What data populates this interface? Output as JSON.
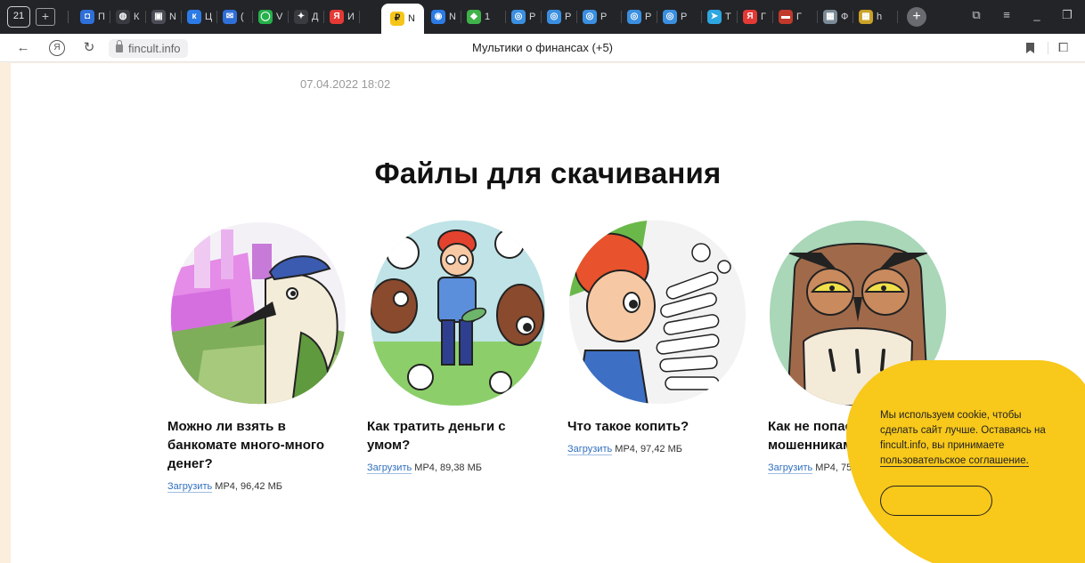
{
  "tabs": [
    {
      "title": "П",
      "color": "#2f6fd8",
      "glyph": "◘"
    },
    {
      "title": "К",
      "color": "#3a3b40",
      "glyph": "◍"
    },
    {
      "title": "N",
      "color": "#4a4b55",
      "glyph": "▣"
    },
    {
      "title": "Ц",
      "color": "#2c7be5",
      "glyph": "к"
    },
    {
      "title": "(",
      "color": "#2f6fd8",
      "glyph": "✉"
    },
    {
      "title": "V",
      "color": "#25b04a",
      "glyph": "◯"
    },
    {
      "title": "Д",
      "color": "#3a3b40",
      "glyph": "✦"
    },
    {
      "title": "И",
      "color": "#e53935",
      "glyph": "Я"
    },
    {
      "title": "N",
      "color": "#f5c518",
      "glyph": "₽"
    },
    {
      "title": "N",
      "color": "#2c7be5",
      "glyph": "◉"
    },
    {
      "title": "1",
      "color": "#3fb24a",
      "glyph": "◆"
    },
    {
      "title": "Р",
      "color": "#3b8fe0",
      "glyph": "◎"
    },
    {
      "title": "Р",
      "color": "#3b8fe0",
      "glyph": "◎"
    },
    {
      "title": "Р",
      "color": "#3b8fe0",
      "glyph": "◎"
    },
    {
      "title": "Р",
      "color": "#3b8fe0",
      "glyph": "◎"
    },
    {
      "title": "Р",
      "color": "#3b8fe0",
      "glyph": "◎"
    },
    {
      "title": "Т",
      "color": "#2ea6e0",
      "glyph": "➤"
    },
    {
      "title": "Г",
      "color": "#e53935",
      "glyph": "Я"
    },
    {
      "title": "Г",
      "color": "#c0392b",
      "glyph": "▬"
    },
    {
      "title": "Ф",
      "color": "#7a8a96",
      "glyph": "▦"
    },
    {
      "title": "h",
      "color": "#c9a227",
      "glyph": "▦"
    }
  ],
  "home_badge": "21",
  "address_bar": {
    "url": "fincult.info",
    "title": "Мультики о финансах (+5)"
  },
  "page": {
    "date": "07.04.2022 18:02",
    "heading": "Файлы для скачивания",
    "cards": [
      {
        "title": "Можно ли взять в банкомате много-много денег?",
        "link": "Загрузить",
        "meta": "MP4, 96,42 МБ"
      },
      {
        "title": "Как тратить деньги с умом?",
        "link": "Загрузить",
        "meta": "MP4, 89,38 МБ"
      },
      {
        "title": "Что такое копить?",
        "link": "Загрузить",
        "meta": "MP4, 97,42 МБ"
      },
      {
        "title": "Как не попасться мошенникам?",
        "link": "Загрузить",
        "meta": "MP4, 75"
      }
    ]
  },
  "cookie": {
    "text": "Мы используем cookie, чтобы сделать сайт лучше. Оставаясь на fincult.info, вы принимаете",
    "link": "пользовательское соглашение."
  },
  "colors": {
    "link": "#2f6fbf",
    "cookie_bg": "#f8c81a",
    "tabbar_bg": "#232428"
  }
}
